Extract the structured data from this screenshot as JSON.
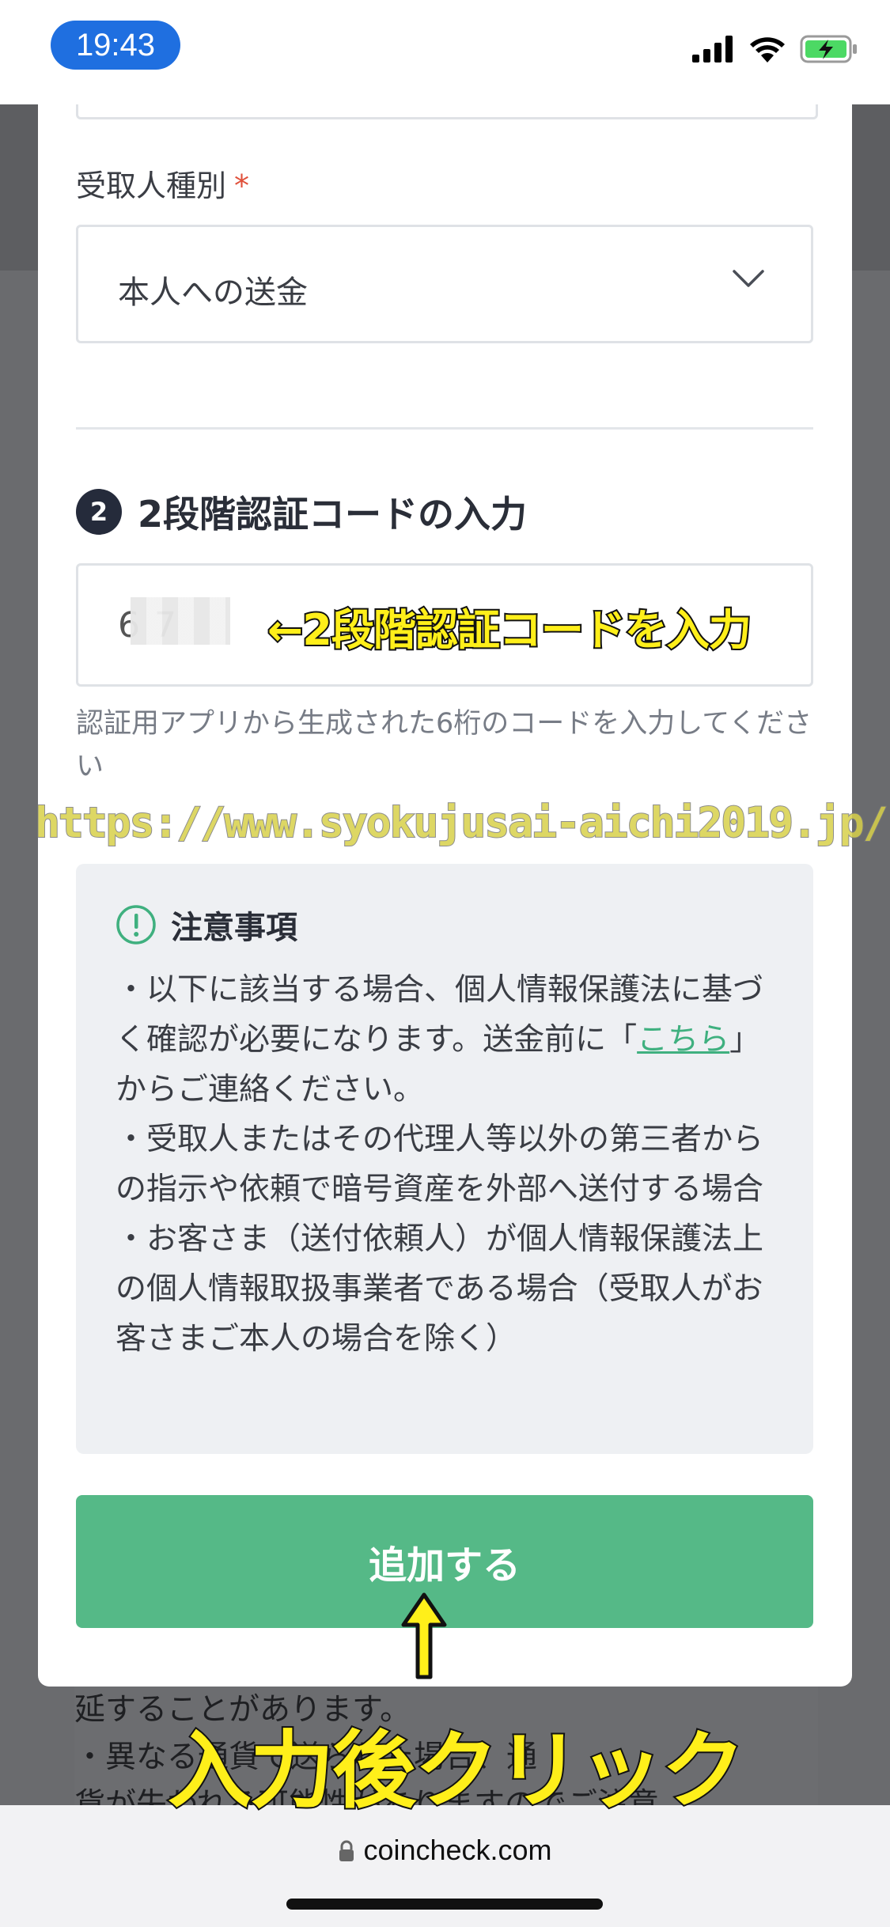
{
  "status_bar": {
    "time": "19:43"
  },
  "form": {
    "recipient_type_label": "受取人種別",
    "required_mark": "*",
    "recipient_type_value": "本人への送金",
    "step_number": "2",
    "section_title": "2段階認証コードの入力",
    "code_value": "6 7",
    "code_hint": "認証用アプリから生成された6桁のコードを入力してください"
  },
  "notice": {
    "title": "注意事項",
    "line1_pre": "・以下に該当する場合、個人情報保護法に基づく確認が必要になります。送金前に「",
    "link_text": "こちら",
    "line1_post": "」からご連絡ください。",
    "line2": "・受取人またはその代理人等以外の第三者からの指示や依頼で暗号資産を外部へ送付する場合",
    "line3": "・お客さま（送付依頼人）が個人情報保護法上の個人情報取扱事業者である場合（受取人がお客さまご本人の場合を除く）"
  },
  "actions": {
    "add_label": "追加する"
  },
  "behind_modal": {
    "line1": "延することがあります。",
    "line2": "・異なる通貨で送られた場合、通",
    "line3": "貨が失われる可能性がありますのでご注意"
  },
  "annotations": {
    "code_note": "←2段階認証コードを入力",
    "click_note": "入力後クリック",
    "watermark": "https://www.syokujusai-aichi2019.jp/"
  },
  "browser": {
    "url": "coincheck.com"
  },
  "colors": {
    "accent_green": "#55b987",
    "link_green": "#3fb07f",
    "time_pill": "#1f6fe0",
    "annotation_yellow": "#ffef1a"
  }
}
